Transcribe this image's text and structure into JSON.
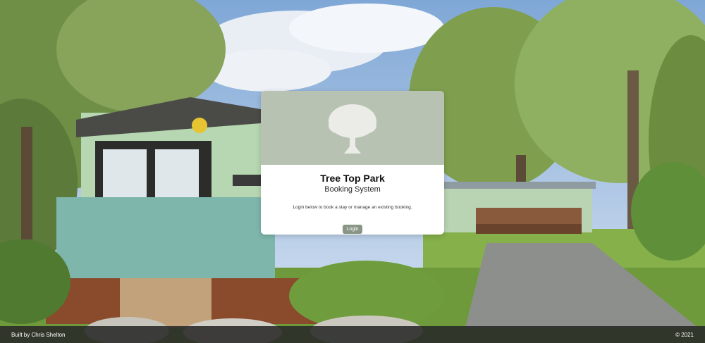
{
  "card": {
    "logo_icon": "tree-icon",
    "title": "Tree Top Park",
    "subtitle": "Booking System",
    "description": "Login below to book a stay or manage an existing booking.",
    "login_label": "Login"
  },
  "footer": {
    "credit": "Built by Chris Shelton",
    "copyright": "© 2021"
  },
  "colors": {
    "header_bg": "#b7c2b2",
    "button_bg": "#8a9585",
    "footer_bg": "#282828"
  }
}
